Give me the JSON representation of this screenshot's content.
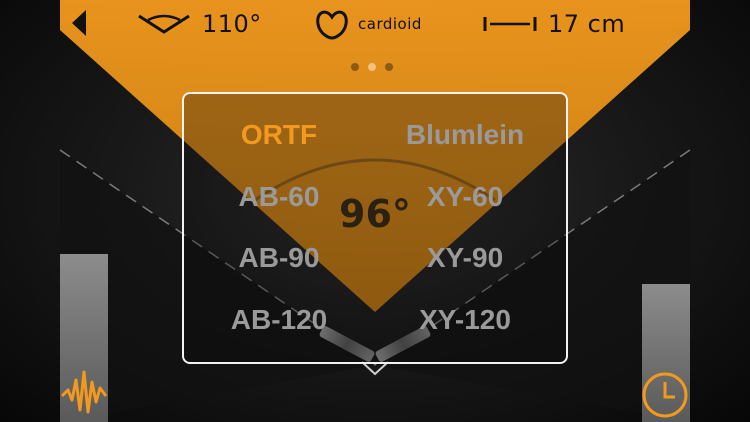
{
  "colors": {
    "accent": "#f39a1e",
    "selected_text": "#f39a1e",
    "preset_text": "#9a9a9a",
    "box_border": "#f2f2f2"
  },
  "top_bar": {
    "back_icon": "back-triangle-icon",
    "angle_value": "110°",
    "angle_icon": "mic-angle-icon",
    "pattern_value": "cardioid",
    "pattern_icon": "cardioid-icon",
    "spacing_value": "17 cm",
    "spacing_icon": "spacing-ruler-icon"
  },
  "page_indicator": {
    "count": 3,
    "active_index": 1
  },
  "presets": {
    "left": [
      "ORTF",
      "AB-60",
      "AB-90",
      "AB-120"
    ],
    "right": [
      "Blumlein",
      "XY-60",
      "XY-90",
      "XY-120"
    ],
    "selected": "ORTF"
  },
  "stage": {
    "angle_readout": "96°"
  },
  "meters": {
    "left_level": 0.67,
    "right_level": 0.55
  },
  "bottom": {
    "left_icon": "waveform-icon",
    "right_icon": "clock-icon"
  }
}
